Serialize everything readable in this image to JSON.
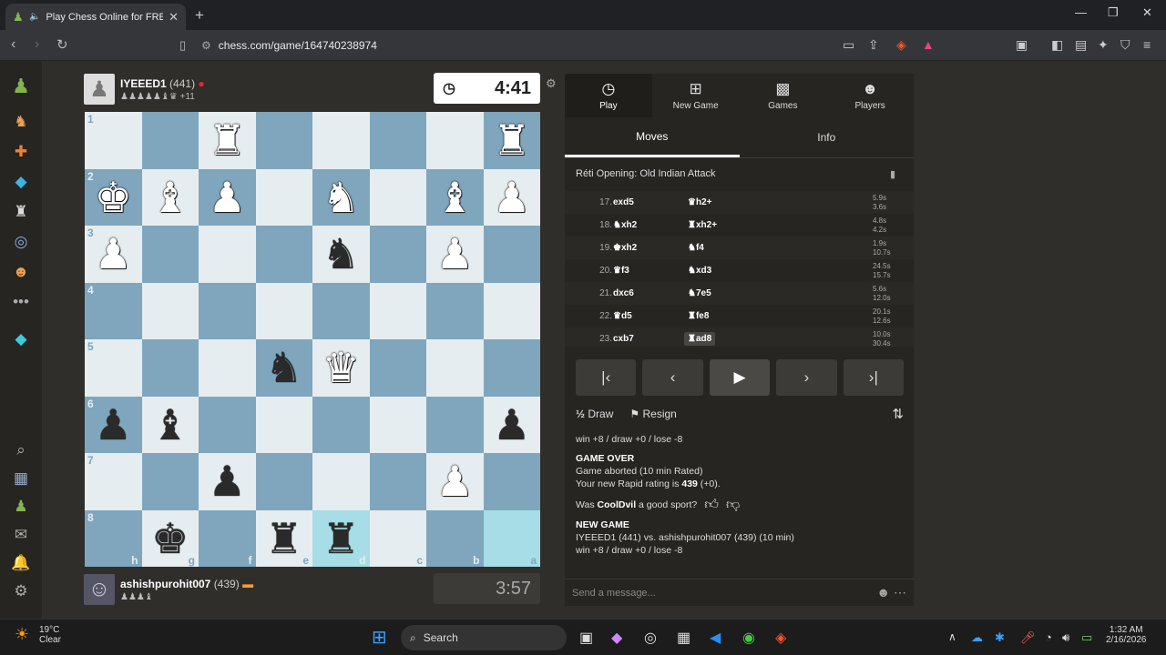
{
  "browser": {
    "tab_title": "Play Chess Online for FREE - C",
    "url": "chess.com/game/164740238974"
  },
  "top_player": {
    "name": "IYEEED1",
    "rating": "(441)",
    "material": "+11",
    "captured": "♟♟♟♟♟♝♛",
    "clock": "4:41"
  },
  "bottom_player": {
    "name": "ashishpurohit007",
    "rating": "(439)",
    "captured": "♟♟♟♝",
    "clock": "3:57"
  },
  "board": {
    "ranks": [
      "1",
      "2",
      "3",
      "4",
      "5",
      "6",
      "7",
      "8"
    ],
    "files": [
      "h",
      "g",
      "f",
      "e",
      "d",
      "c",
      "b",
      "a"
    ],
    "squares": [
      [
        "",
        "",
        "♜w",
        "",
        "",
        "",
        "",
        "♜w"
      ],
      [
        "♚w",
        "♝w",
        "♟w",
        "",
        "♞w",
        "",
        "♝w",
        "♟w"
      ],
      [
        "♟w",
        "",
        "",
        "",
        "♞b",
        "",
        "♟w",
        ""
      ],
      [
        "",
        "",
        "",
        "",
        "",
        "",
        "",
        ""
      ],
      [
        "",
        "",
        "",
        "♞b",
        "♛w",
        "",
        "",
        ""
      ],
      [
        "♟b",
        "♝b",
        "",
        "",
        "",
        "",
        "",
        "♟b"
      ],
      [
        "",
        "",
        "♟b",
        "",
        "",
        "",
        "♟w",
        ""
      ],
      [
        "",
        "♚b",
        "",
        "♜b",
        "♜b",
        "",
        "",
        ""
      ]
    ]
  },
  "panel": {
    "tabs": [
      {
        "label": "Play",
        "icon": "stopwatch-icon"
      },
      {
        "label": "New Game",
        "icon": "plus-icon"
      },
      {
        "label": "Games",
        "icon": "board-icon"
      },
      {
        "label": "Players",
        "icon": "people-icon"
      }
    ],
    "subtabs": [
      "Moves",
      "Info"
    ],
    "opening": "Réti Opening: Old Indian Attack",
    "moves": [
      {
        "n": "17.",
        "w": "exd5",
        "b": "♛h2+",
        "t1": "5.9s",
        "t2": "3.6s"
      },
      {
        "n": "18.",
        "w": "♞xh2",
        "b": "♜xh2+",
        "t1": "4.8s",
        "t2": "4.2s"
      },
      {
        "n": "19.",
        "w": "♚xh2",
        "b": "♞f4",
        "t1": "1.9s",
        "t2": "10.7s"
      },
      {
        "n": "20.",
        "w": "♛f3",
        "b": "♞xd3",
        "t1": "24.5s",
        "t2": "15.7s"
      },
      {
        "n": "21.",
        "w": "dxc6",
        "b": "♞7e5",
        "t1": "5.6s",
        "t2": "12.0s"
      },
      {
        "n": "22.",
        "w": "♛d5",
        "b": "♜fe8",
        "t1": "20.1s",
        "t2": "12.6s"
      },
      {
        "n": "23.",
        "w": "cxb7",
        "b": "♜ad8",
        "t1": "10.0s",
        "t2": "30.4s"
      }
    ],
    "draw_label": "Draw",
    "draw_icon": "½",
    "resign_label": "Resign",
    "log": {
      "line1": "win +8 / draw +0 / lose -8",
      "game_over": "GAME OVER",
      "aborted": "Game aborted (10 min Rated)",
      "rating_prefix": "Your new Rapid rating is ",
      "rating_value": "439",
      "rating_suffix": " (+0).",
      "sport_prefix": "Was ",
      "sport_name": "CoolDvil",
      "sport_suffix": " a good sport?",
      "new_game": "NEW GAME",
      "match_p1": "IYEEED1",
      "match_mid": " (441) vs. ",
      "match_p2": "ashishpurohit007",
      "match_suffix": " (439) (10 min)",
      "line_end": "win +8 / draw +0 / lose -8"
    },
    "message_placeholder": "Send a message..."
  },
  "taskbar": {
    "weather_temp": "19°C",
    "weather_desc": "Clear",
    "search_label": "Search",
    "time": "1:32 AM",
    "date": "2/16/2026"
  },
  "colors": {
    "light_square": "#e6edf0",
    "dark_square": "#7fa6bd",
    "highlight": "#a6dde6",
    "brand_green": "#81b64c"
  }
}
